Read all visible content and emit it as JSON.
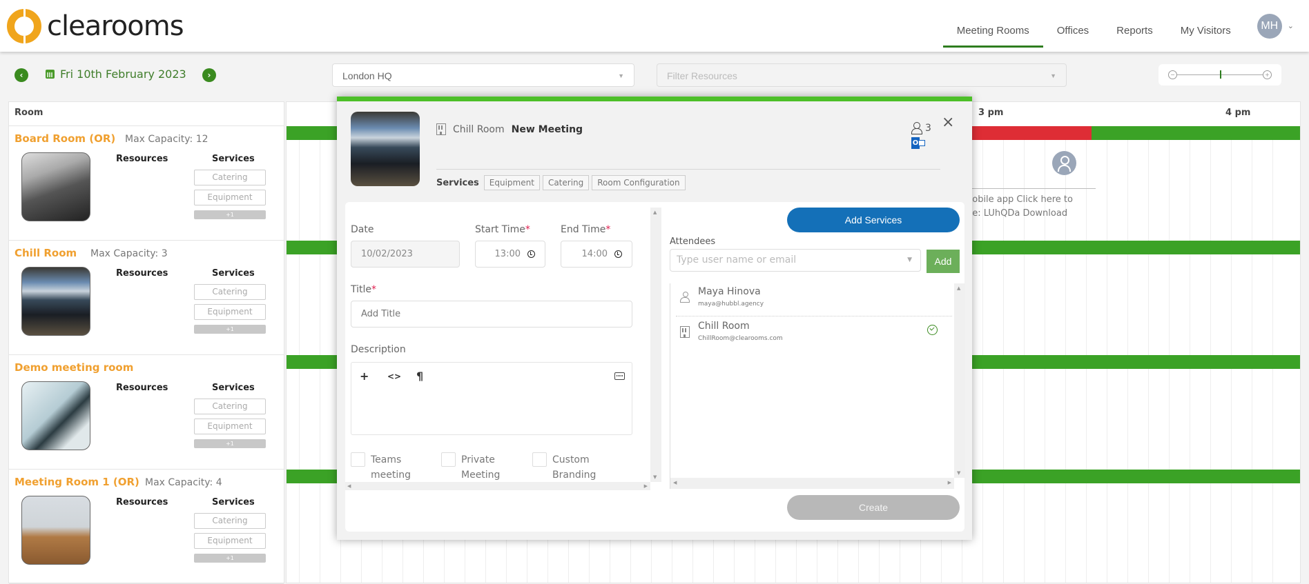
{
  "brand": {
    "name": "clearooms",
    "logo_color": "#f0a51c"
  },
  "nav": {
    "items": [
      {
        "label": "Meeting Rooms",
        "active": true
      },
      {
        "label": "Offices",
        "active": false
      },
      {
        "label": "Reports",
        "active": false
      },
      {
        "label": "My Visitors",
        "active": false
      }
    ],
    "user_initials": "MH"
  },
  "toolbar": {
    "date": "Fri 10th February 2023",
    "location": "London HQ",
    "filter_placeholder": "Filter Resources",
    "accent": "#3a8a1f"
  },
  "rooms_panel": {
    "header": "Room",
    "resources_label": "Resources",
    "services_label": "Services",
    "rooms": [
      {
        "name": "Board Room (OR)",
        "capacity": "Max Capacity: 12",
        "services": [
          "Catering",
          "Equipment"
        ],
        "more": "+1"
      },
      {
        "name": "Chill Room",
        "capacity": "Max Capacity: 3",
        "services": [
          "Catering",
          "Equipment"
        ],
        "more": "+1"
      },
      {
        "name": "Demo meeting room",
        "capacity": "",
        "services": [
          "Catering",
          "Equipment"
        ],
        "more": "+1"
      },
      {
        "name": "Meeting Room 1 (OR)",
        "capacity": "Max Capacity: 4",
        "services": [
          "Catering",
          "Equipment"
        ],
        "more": "+1"
      }
    ]
  },
  "schedule": {
    "hour_labels": [
      "3 pm",
      "4 pm"
    ],
    "booking_text_line1": "nobile app Click here to",
    "booking_text_line2": "de: LUhQDa Download",
    "available_color": "#3ba226",
    "busy_color": "#de2d35"
  },
  "modal": {
    "room": "Chill Room",
    "title": "New Meeting",
    "attendee_count": "3",
    "outlook_letter": "O",
    "close": "×",
    "services_label": "Services",
    "service_tabs": [
      "Equipment",
      "Catering",
      "Room Configuration"
    ],
    "form": {
      "date_label": "Date",
      "date_value": "10/02/2023",
      "start_label": "Start Time",
      "start_value": "13:00",
      "end_label": "End Time",
      "end_value": "14:00",
      "title_label": "Title",
      "title_placeholder": "Add Title",
      "description_label": "Description",
      "editor_tools": [
        "+",
        "<>",
        "¶"
      ],
      "required_mark": "*",
      "checkboxes": [
        {
          "label": "Teams meeting",
          "checked": false
        },
        {
          "label": "Private Meeting",
          "checked": false
        },
        {
          "label": "Custom Branding",
          "checked": false
        }
      ]
    },
    "add_services_label": "Add Services",
    "attendees_label": "Attendees",
    "attendee_placeholder": "Type user name or email",
    "add_label": "Add",
    "attendees": [
      {
        "name": "Maya Hinova",
        "email": "maya@hubbl.agency",
        "type": "person",
        "confirmed": false
      },
      {
        "name": "Chill Room",
        "email": "ChillRoom@clearooms.com",
        "type": "room",
        "confirmed": true
      }
    ],
    "create_label": "Create"
  }
}
